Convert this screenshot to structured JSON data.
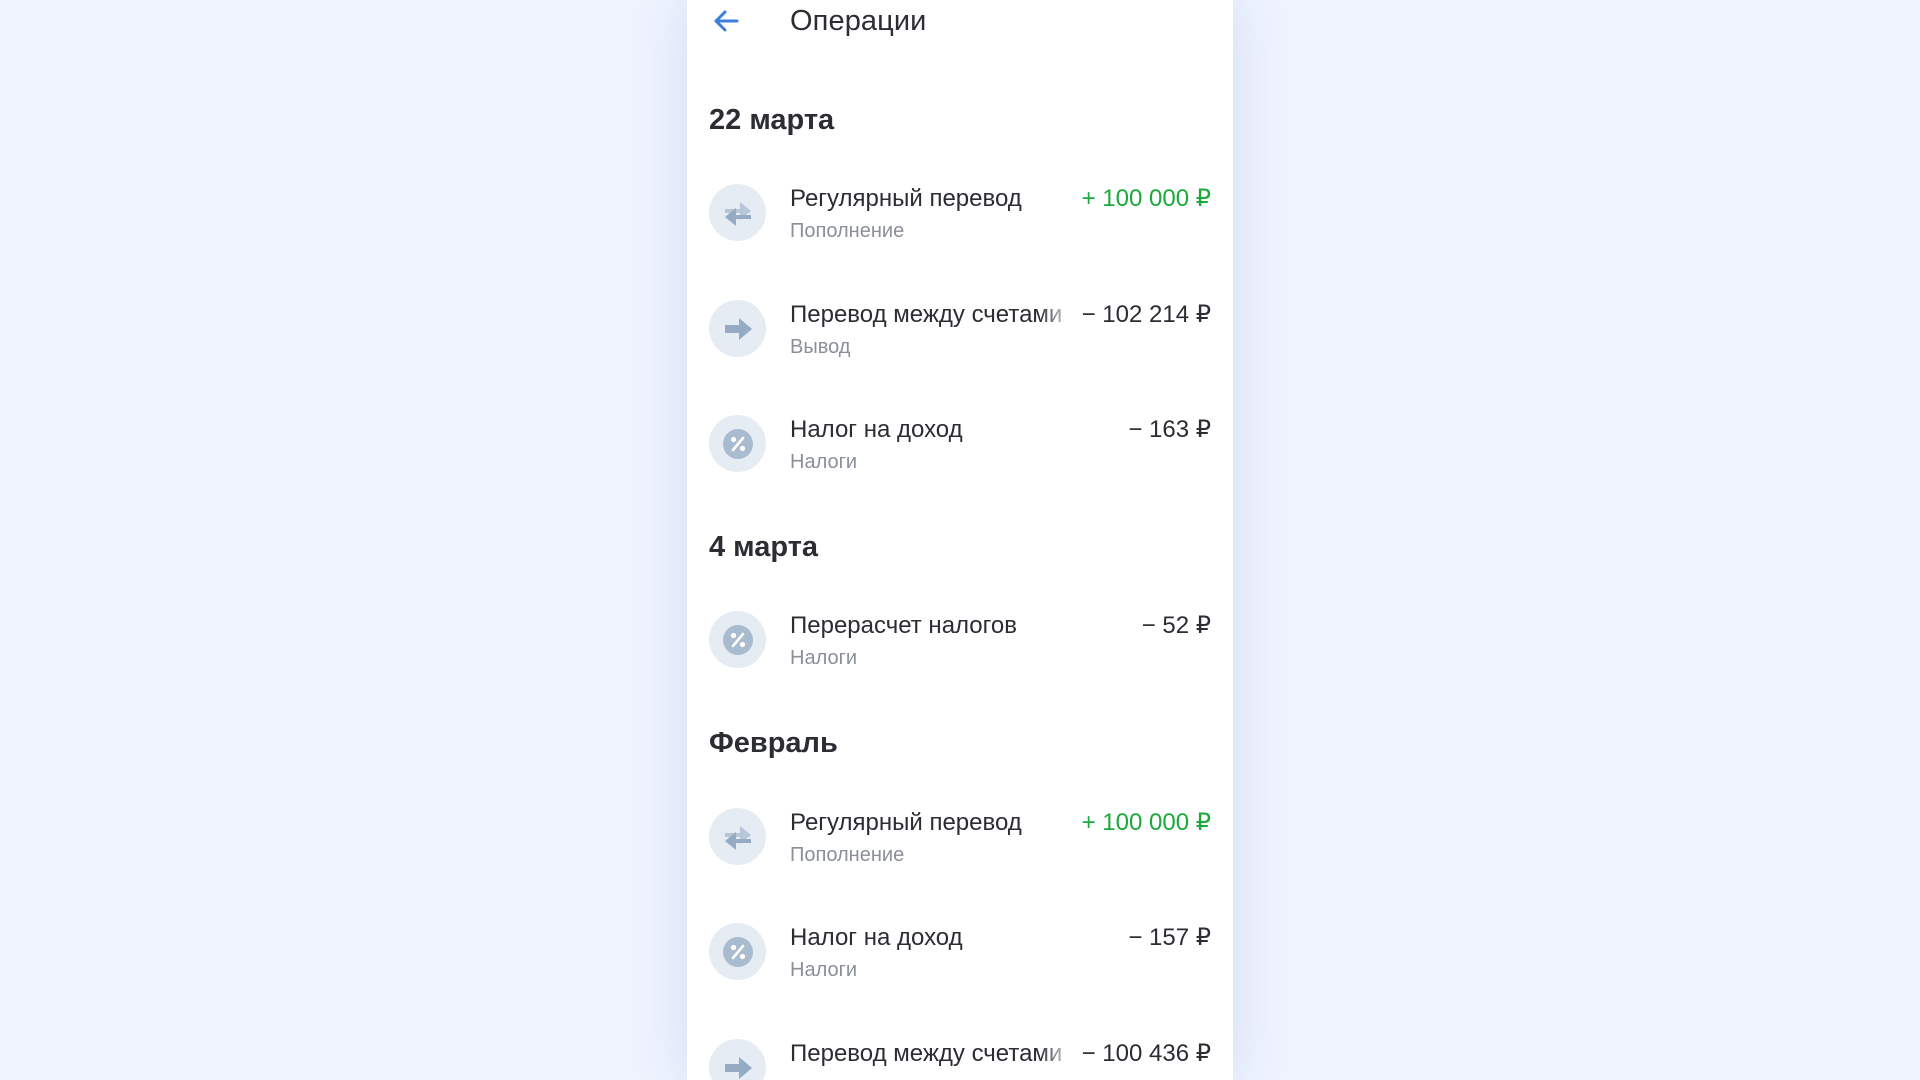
{
  "header": {
    "title": "Операции"
  },
  "sections": [
    {
      "title": "22 марта",
      "items": [
        {
          "name": "Регулярный перевод",
          "category": "Пополнение",
          "amount": "+ 100 000 ₽",
          "icon": "transfer-in-icon",
          "positive": true
        },
        {
          "name": "Перевод между счетами",
          "category": "Вывод",
          "amount": "− 102 214 ₽",
          "icon": "transfer-out-icon",
          "positive": false
        },
        {
          "name": "Налог на доход",
          "category": "Налоги",
          "amount": "− 163 ₽",
          "icon": "percent-icon",
          "positive": false
        }
      ]
    },
    {
      "title": "4 марта",
      "items": [
        {
          "name": "Перерасчет налогов",
          "category": "Налоги",
          "amount": "− 52 ₽",
          "icon": "percent-icon",
          "positive": false
        }
      ]
    },
    {
      "title": "Февраль",
      "items": [
        {
          "name": "Регулярный перевод",
          "category": "Пополнение",
          "amount": "+ 100 000 ₽",
          "icon": "transfer-in-icon",
          "positive": true
        },
        {
          "name": "Налог на доход",
          "category": "Налоги",
          "amount": "− 157 ₽",
          "icon": "percent-icon",
          "positive": false
        },
        {
          "name": "Перевод между счетами",
          "category": "",
          "amount": "− 100 436 ₽",
          "icon": "transfer-out-icon",
          "positive": false
        }
      ]
    }
  ],
  "colors": {
    "background": "#eef3fe",
    "panel": "#ffffff",
    "text": "#2b2d33",
    "muted": "#8a8f99",
    "positive": "#1aaa3c",
    "accent": "#3b7fdb",
    "icon_bg": "#e6ecf3",
    "icon_fg": "#9bb0c6"
  }
}
